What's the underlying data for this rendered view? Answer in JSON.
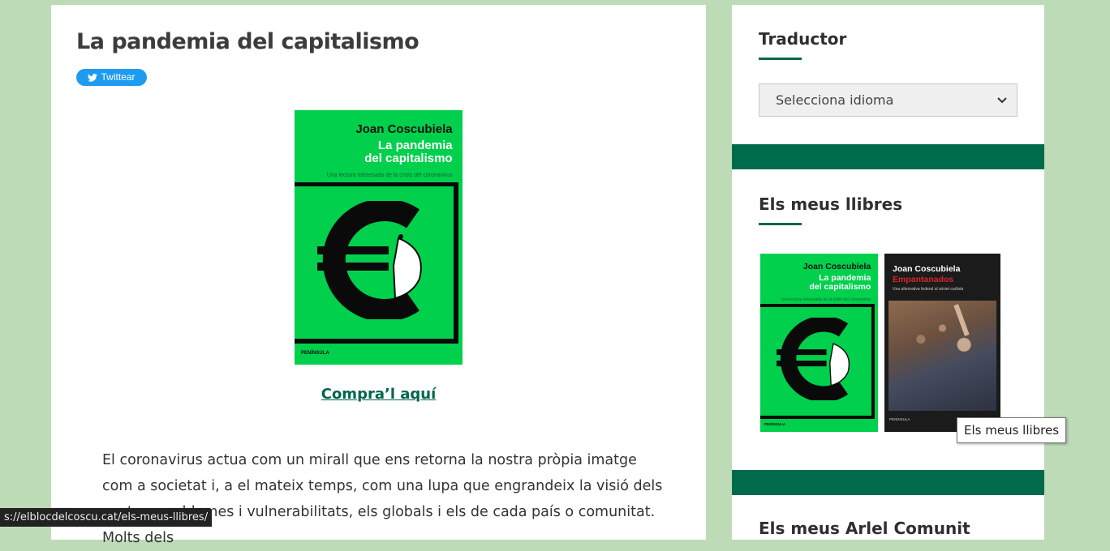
{
  "post": {
    "title": "La pandemia del capitalismo",
    "twitter_label": "Twittear",
    "buy_link": "Compra’l aquí",
    "body": "El coronavirus actua com un mirall que ens retorna la nostra pròpia imatge com a societat i, a el mateix temps, com una lupa que engrandeix la visió dels nostres problemes i vulnerabilitats, els globals i els de cada país o comunitat. Molts dels"
  },
  "book_cover": {
    "author": "Joan Coscubiela",
    "title_line1": "La pandemia",
    "title_line2": "del capitalismo",
    "subtitle": "Una lectura interesada de la crisis del coronavirus",
    "publisher": "PENÍNSULA",
    "icon": "euro-sign-with-face-mask-icon",
    "colors": {
      "background": "#00d04c",
      "frame": "#0a0a0a"
    }
  },
  "second_book": {
    "author": "Joan Coscubiela",
    "title": "Empantanados",
    "subtitle": "Una alternativa federal al sóviet carlista",
    "publisher": "PENÍNSULA"
  },
  "sidebar": {
    "translator_title": "Traductor",
    "language_select_value": "Selecciona idioma",
    "books_title": "Els meus llibres",
    "next_title": "Els meus Arlel Comunit"
  },
  "tooltip": "Els meus llibres",
  "status_url": "s://elblocdelcoscu.cat/els-meus-llibres/",
  "theme": {
    "accent": "#006b4b",
    "page_bg": "#bcdbb6",
    "link": "#00664a",
    "twitter": "#1d9bf0"
  }
}
